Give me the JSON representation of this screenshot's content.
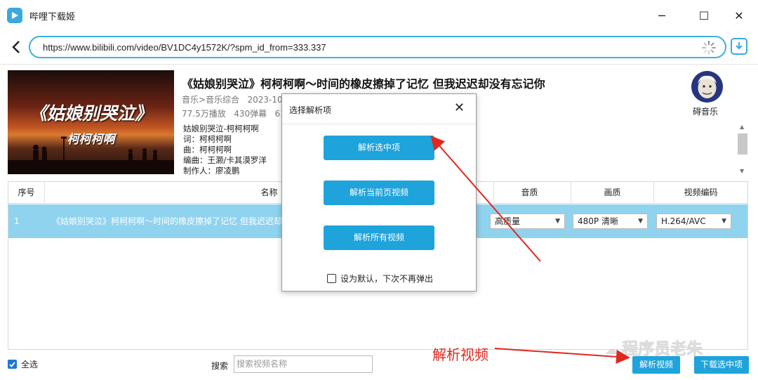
{
  "window": {
    "title": "哔哩下载姬",
    "minimize": "─",
    "maximize": "☐",
    "close": "✕"
  },
  "nav": {
    "url": "https://www.bilibili.com/video/BV1DC4y1572K/?spm_id_from=333.337"
  },
  "video": {
    "thumb_title": "《姑娘别哭泣》",
    "thumb_subtitle": "柯柯柯啊",
    "title": "《姑娘别哭泣》柯柯柯啊～时间的橡皮擦掉了记忆 但我迟迟却没有忘记你",
    "category": "音乐>音乐综合",
    "date": "2023-10-",
    "plays": "77.5万播放",
    "danmaku": "430弹幕",
    "likes": "612",
    "description": [
      "姑娘别哭泣-柯柯柯啊",
      "词：柯柯柯啊",
      "曲：柯柯柯啊",
      "编曲：王灏/卡其漠罗洋",
      "制作人：廖凌鹏"
    ]
  },
  "uploader": {
    "name": "碍音乐"
  },
  "table": {
    "headers": {
      "index": "序号",
      "name": "名称",
      "quality": "音质",
      "resolution": "画质",
      "codec": "视频编码"
    },
    "rows": [
      {
        "index": "1",
        "name": "《姑娘别哭泣》柯柯柯啊～时间的橡皮擦掉了记忆 但我迟迟却没",
        "quality": "高质量",
        "resolution": "480P 清晰",
        "codec": "H.264/AVC"
      }
    ]
  },
  "dialog": {
    "title": "选择解析项",
    "close": "✕",
    "btn_selected": "解析选中项",
    "btn_current_page": "解析当前页视频",
    "btn_all": "解析所有视频",
    "default_checkbox": "设为默认，下次不再弹出"
  },
  "footer": {
    "select_all": "全选",
    "search_label": "搜索",
    "search_placeholder": "搜索视频名称",
    "parse_button": "解析视频",
    "download_button": "下载选中项"
  },
  "annotation": {
    "label": "解析视频",
    "color": "#e0281d"
  },
  "watermark": {
    "text": "程序员老朱"
  },
  "colors": {
    "accent": "#1ea3db",
    "row_selected": "#8fd3ef",
    "url_border": "#3fb0d9"
  }
}
